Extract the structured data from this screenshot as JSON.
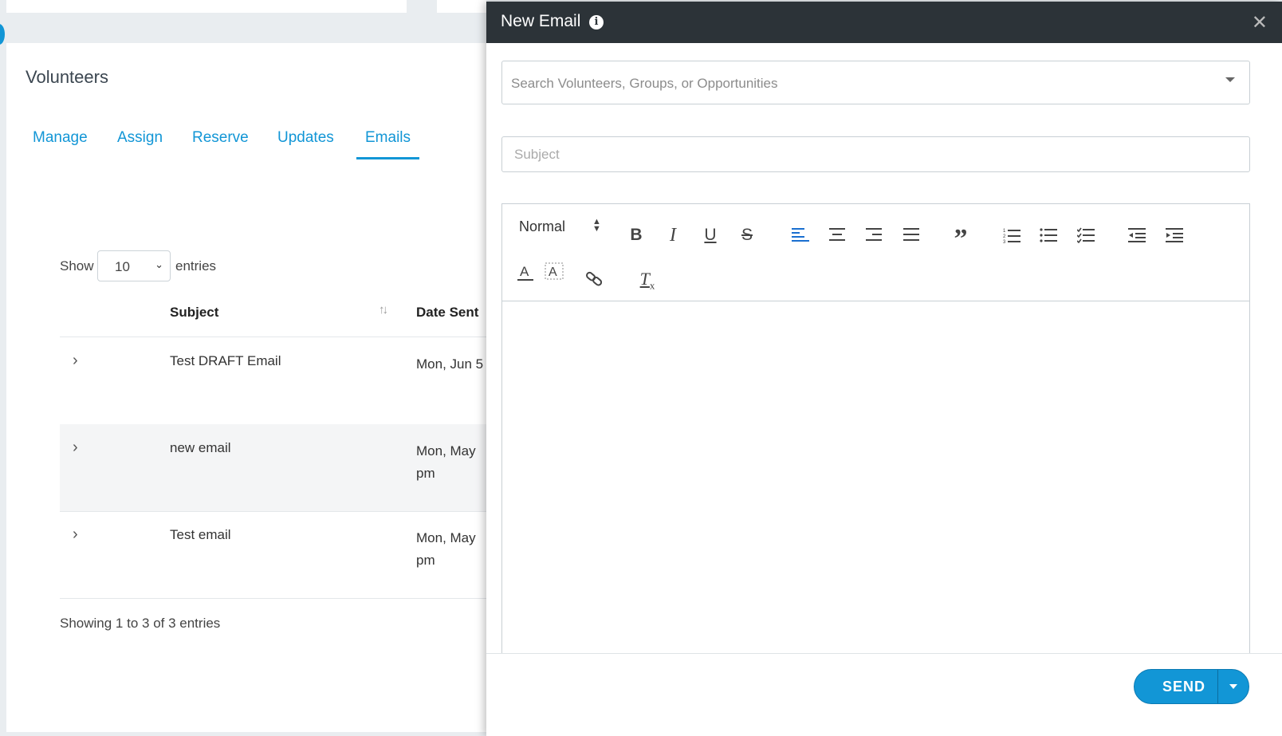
{
  "page": {
    "title": "Volunteers",
    "tabs": [
      "Manage",
      "Assign",
      "Reserve",
      "Updates",
      "Emails"
    ],
    "active_tab": "Emails",
    "show_label": "Show",
    "entries_value": "10",
    "entries_label": "entries",
    "table": {
      "columns": [
        "Subject",
        "Date Sent"
      ],
      "rows": [
        {
          "subject": "Test DRAFT Email",
          "date": "Mon, Jun 5"
        },
        {
          "subject": "new email",
          "date": "Mon, May\npm"
        },
        {
          "subject": "Test email",
          "date": "Mon, May\npm"
        }
      ]
    },
    "info": "Showing 1 to 3 of 3 entries"
  },
  "modal": {
    "title": "New Email",
    "info_icon": "i",
    "close_icon": "✕",
    "recipients_placeholder": "Search Volunteers, Groups, or Opportunities",
    "subject_placeholder": "Subject",
    "toolbar": {
      "format": "Normal",
      "bold": "B",
      "italic": "I",
      "underline": "U",
      "strike": "S",
      "quote": "”",
      "clear_format": "T"
    },
    "send_label": "SEND"
  },
  "colors": {
    "accent": "#1296d6",
    "modal_header": "#2c3338",
    "active_align": "#1a6fd0"
  }
}
